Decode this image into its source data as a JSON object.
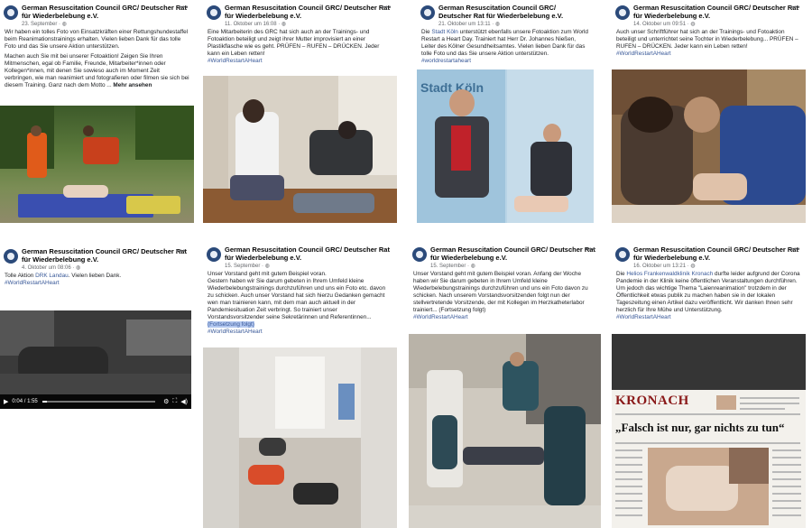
{
  "posts": [
    {
      "author": "German Resuscitation Council GRC/ Deutscher Rat für Wiederbelebung e.V.",
      "date": "23. September · ",
      "text1": "Wir haben ein tolles Foto von Einsatzkräften einer Rettungshundestaffel beim Reanimationstrainings erhalten. Vielen lieben Dank für das tolle Foto und das Sie unsere Aktion unterstützen.",
      "text2": "Machen auch Sie mit bei unserer Fotoaktion! Zeigen Sie Ihren Mitmenschen, egal ob Familie, Freunde, Mitarbeiter*innen oder Kollegen*innen, mit denen Sie sowieso auch im Moment Zeit verbringen, wie man reanimiert und fotografieren oder filmen sie sich bei diesem Training. Ganz nach dem Motto ...",
      "more": "Mehr ansehen"
    },
    {
      "author": "German Resuscitation Council GRC/ Deutscher Rat für Wiederbelebung e.V.",
      "date": "11. Oktober um 16:08 · ",
      "text1": "Eine Mitarbeiterin des GRC hat sich auch an der Trainings- und Fotoaktion beteiligt und zeigt ihrer Mutter improvisiert an einer Plastikflasche wie es geht. PRÜFEN – RUFEN – DRÜCKEN. Jeder kann ein Leben retten!",
      "tag": "#WorldRestartAHeart"
    },
    {
      "author": "German Resuscitation Council GRC/ Deutscher Rat für Wiederbelebung e.V.",
      "date": "21. Oktober um 13:11 · ",
      "pre": "Die ",
      "link": "Stadt Köln",
      "text1": " unterstützt ebenfalls unsere Fotoaktion zum World Restart a Heart Day. Trainiert hat Herr Dr. Johannes Nießen, Leiter des Kölner Gesundheitsamtes. Vielen lieben Dank für das tolle Foto und das Sie unsere Aktion unterstützen.",
      "tag": "#worldrestartaheart",
      "sign_text": "Stadt Köln"
    },
    {
      "author": "German Resuscitation Council GRC/ Deutscher Rat für Wiederbelebung e.V.",
      "date": "14. Oktober um 09:51 · ",
      "text1": "Auch unser Schriftführer hat sich an der Trainings- und Fotoaktion beteiligt und unterrichtet seine Tochter in Wiederbelebung... PRÜFEN – RUFEN – DRÜCKEN. Jeder kann ein Leben retten!",
      "tag": "#WorldRestartAHeart"
    },
    {
      "author": "German Resuscitation Council GRC/ Deutscher Rat für Wiederbelebung e.V.",
      "date": "4. Oktober um 08:06 · ",
      "pre": "Tolle Aktion ",
      "link": "DRK Landau",
      "text1": ". Vielen lieben Dank.",
      "tag": "#WorldRestartAHeart",
      "video_time": "0:04 / 1:55",
      "video_progress": 0.04
    },
    {
      "author": "German Resuscitation Council GRC/ Deutscher Rat für Wiederbelebung e.V.",
      "date": "15. September · ",
      "text1": "Unser Vorstand geht mit gutem Beispiel voran.",
      "text2": "Gestern haben wir Sie darum gebeten in Ihrem Umfeld kleine Wiederbelebungstrainings durchzuführen und uns ein Foto etc. davon zu schicken. Auch unser Vorstand hat sich hierzu Gedanken gemacht wen man trainieren kann, mit dem man auch aktuell in der Pandemiesituation Zeit verbringt. So trainiert unser Vorstandsvorsitzender seine Sekretärinnen und Referentinnen...",
      "continued": "(Fortsetzung folgt)",
      "tag": "#WorldRestartAHeart"
    },
    {
      "author": "German Resuscitation Council GRC/ Deutscher Rat für Wiederbelebung e.V.",
      "date": "15. September · ",
      "text1": "Unser Vorstand geht mit gutem Beispiel voran. Anfang der Woche haben wir Sie darum gebeten in Ihrem Umfeld kleine Wiederbelebungstrainings durchzuführen und uns ein Foto davon zu schicken. Nach unserem Vorstandsvorsitzenden folgt nun der stellvertretende Vorsitzende, der mit Kollegen im Herzkatheterlabor trainiert... (Fortsetzung folgt)",
      "tag": "#WorldRestartAHeart"
    },
    {
      "author": "German Resuscitation Council GRC/ Deutscher Rat für Wiederbelebung e.V.",
      "date": "16. Oktober um 13:21 · ",
      "pre": "Die ",
      "link": "Helios Frankenwaldklinik Kronach",
      "text1": " durfte leider aufgrund der Corona Pandemie in der Klinik keine öffentlichen Veranstaltungen durchführen. Um jedoch das wichtige Thema \"Laienreanimation\" trotzdem in der Öffentlichkeit etwas publik zu machen haben sie in der lokalen Tageszeitung einen Artikel dazu veröffentlicht. Wir danken Ihnen sehr herzlich für Ihre Mühe und Unterstützung.",
      "tag": "#WorldRestartAHeart",
      "np_title": "KRONACH",
      "np_headline": "„Falsch ist nur, gar nichts zu tun“"
    }
  ],
  "colors": {
    "link": "#385898",
    "brand": "#2b4a7a",
    "newspaper_red": "#8a1919"
  },
  "icons": {
    "more_options": "ellipsis-icon",
    "avatar": "grc-logo-avatar"
  }
}
